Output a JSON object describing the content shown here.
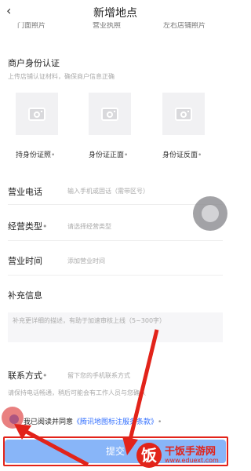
{
  "nav": {
    "title": "新增地点",
    "back_icon": "‹"
  },
  "cut_row": {
    "items": [
      "门面照片",
      "营业执照",
      "左右店铺照片"
    ]
  },
  "merchant_auth": {
    "title": "商户身份认证",
    "subtitle": "上传店铺认证材料，确保商户信息正确",
    "uploads": [
      {
        "label": "持身份证照",
        "req": "•"
      },
      {
        "label": "身份证正面",
        "req": "•"
      },
      {
        "label": "身份证反面",
        "req": "•"
      }
    ]
  },
  "fields": {
    "phone": {
      "label": "营业电话",
      "placeholder": "输入手机或固话（需带区号）"
    },
    "type": {
      "label": "经营类型",
      "req": "•",
      "placeholder": "请选择经营类型"
    },
    "hours": {
      "label": "营业时间",
      "placeholder": "添加营业时间"
    }
  },
  "extra": {
    "title": "补充信息",
    "placeholder": "补充更详细的描述，有助于加速审核上线（5~300字）"
  },
  "contact": {
    "label": "联系方式",
    "req": "•",
    "placeholder": "留下您的手机联系方式",
    "note": "请保持电话畅通，稍后可能会有工作人员与您确认"
  },
  "agreement": {
    "prefix": "我已阅读并同意",
    "link": "《腾讯地图标注服务条款》",
    "req": "•"
  },
  "submit": {
    "label": "提交"
  },
  "watermark": {
    "logo_char": "饭",
    "name": "干饭手游网",
    "url": "www.eduext.com"
  },
  "colors": {
    "accent": "#3370ff",
    "annotation": "#e2231a",
    "submit_bg": "#88b5f8"
  }
}
